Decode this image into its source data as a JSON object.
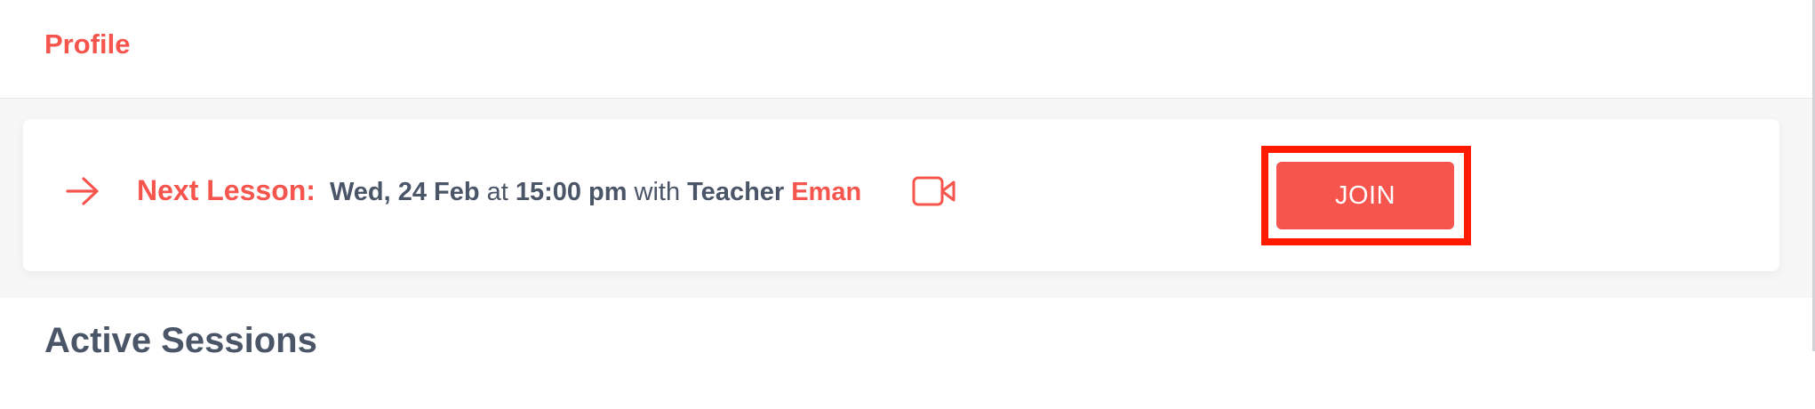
{
  "header": {
    "profile_label": "Profile"
  },
  "next_lesson": {
    "label": "Next Lesson:",
    "date": "Wed, 24 Feb",
    "at_word": "at",
    "time": "15:00 pm",
    "with_word": "with",
    "teacher_word": "Teacher",
    "teacher_name": "Eman",
    "join_label": "JOIN"
  },
  "sections": {
    "active_sessions_title": "Active Sessions"
  },
  "icons": {
    "arrow": "arrow-right-icon",
    "video": "video-camera-icon"
  },
  "colors": {
    "accent": "#f5554d",
    "text": "#4a5568",
    "highlight": "#ff1a00"
  }
}
